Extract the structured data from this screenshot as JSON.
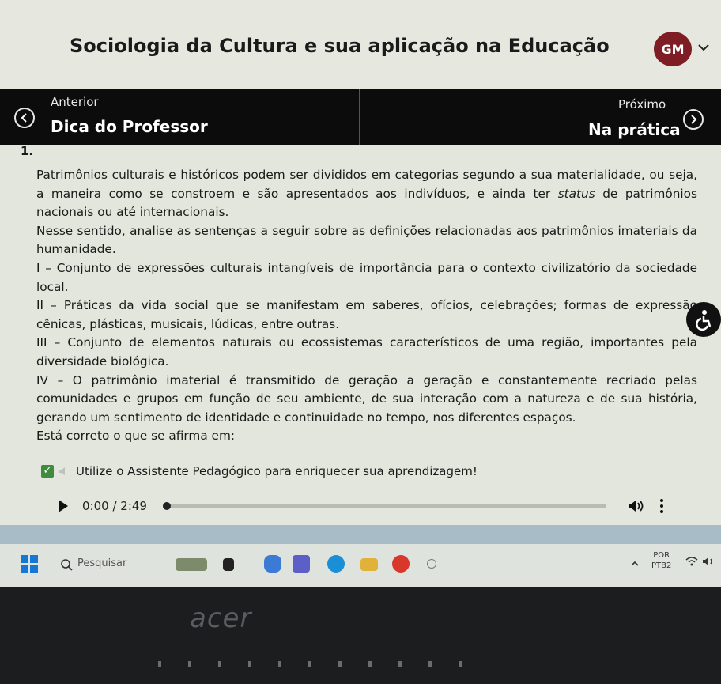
{
  "header": {
    "course_title": "Sociologia da Cultura e sua aplicação na Educação",
    "avatar_initials": "GM"
  },
  "nav": {
    "prev_small": "Anterior",
    "prev_big": "Dica do Professor",
    "next_small": "Próximo",
    "next_big": "Na prática"
  },
  "question": {
    "number": "1.",
    "p1_before": "Patrimônios culturais e históricos podem ser divididos em categorias segundo a sua materialidade, ou seja, a maneira como se constroem e são apresentados aos indivíduos, e ainda ter ",
    "p1_italic": "status",
    "p1_after": " de patrimônios nacionais ou até internacionais.",
    "p2": "Nesse sentido, analise as sentenças a seguir sobre as definições relacionadas aos patrimônios imateriais da humanidade.",
    "item_i": "I – Conjunto de expressões culturais intangíveis de importância para o contexto civilizatório da sociedade local.",
    "item_ii": "II – Práticas da vida social que se manifestam em saberes, ofícios, celebrações; formas de expressão cênicas, plásticas, musicais, lúdicas, entre outras.",
    "item_iii": "III – Conjunto de elementos naturais ou ecossistemas característicos de uma região, importantes pela diversidade biológica.",
    "item_iv": "IV – O patrimônio imaterial é transmitido de geração a geração e constantemente recriado pelas comunidades e grupos em função de seu ambiente, de sua interação com a natureza e de sua história, gerando um sentimento de identidade e continuidade no tempo, nos diferentes espaços.",
    "prompt": "Está correto o que se afirma em:"
  },
  "assistant": {
    "label": "Utilize o Assistente Pedagógico para enriquecer sua aprendizagem!",
    "checked": true
  },
  "audio": {
    "time": "0:00 / 2:49",
    "progress": 0
  },
  "taskbar": {
    "search_placeholder": "Pesquisar",
    "lang_line1": "POR",
    "lang_line2": "PTB2"
  },
  "laptop": {
    "brand": "acer"
  },
  "colors": {
    "avatar": "#7e1d24",
    "navbar": "#0c0c0c",
    "checkbox": "#3f8d3c",
    "background": "#e3e6dc"
  }
}
